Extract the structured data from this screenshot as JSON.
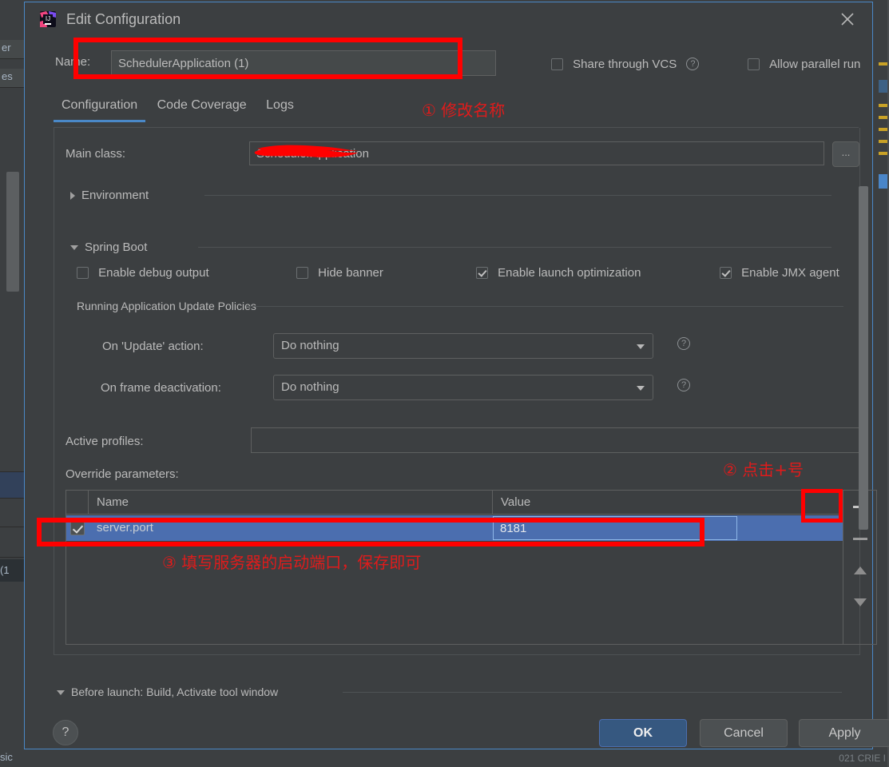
{
  "window": {
    "title": "Edit Configuration",
    "logo_icon": "intellij-idea-logo",
    "close_icon": "close-icon"
  },
  "name_row": {
    "label": "Name:",
    "value": "SchedulerApplication (1)",
    "share_vcs": {
      "label": "Share through VCS",
      "checked": false,
      "help_icon": "?"
    },
    "allow_parallel": {
      "label": "Allow parallel run",
      "checked": false
    }
  },
  "tabs": [
    {
      "label": "Configuration",
      "active": true
    },
    {
      "label": "Code Coverage",
      "active": false
    },
    {
      "label": "Logs",
      "active": false
    }
  ],
  "configuration": {
    "main_class": {
      "label": "Main class:",
      "value": "SchedulerApplication",
      "browse_label": "..."
    },
    "environment": {
      "label": "Environment",
      "expanded": false,
      "triangle_icon": "triangle-right-icon"
    },
    "spring_boot": {
      "label": "Spring Boot",
      "expanded": true,
      "triangle_icon": "triangle-down-icon"
    },
    "boot_checkboxes": [
      {
        "label": "Enable debug output",
        "checked": false
      },
      {
        "label": "Hide banner",
        "checked": false
      },
      {
        "label": "Enable launch optimization",
        "checked": true
      },
      {
        "label": "Enable JMX agent",
        "checked": true
      }
    ],
    "policies": {
      "title": "Running Application Update Policies",
      "update_action": {
        "label": "On 'Update' action:",
        "value": "Do nothing",
        "help_icon": "?"
      },
      "frame_deactivation": {
        "label": "On frame deactivation:",
        "value": "Do nothing",
        "help_icon": "?"
      }
    },
    "active_profiles": {
      "label": "Active profiles:",
      "value": "",
      "placeholder": ""
    },
    "override_parameters": {
      "label": "Override parameters:",
      "columns": [
        "Name",
        "Value"
      ],
      "rows": [
        {
          "checked": true,
          "name": "server.port",
          "value": "8181",
          "selected": true
        }
      ],
      "tools": {
        "add": "+",
        "remove": "−",
        "move_up": "move-up-icon",
        "move_down": "move-down-icon"
      }
    }
  },
  "before_launch": {
    "label": "Before launch: Build, Activate tool window",
    "triangle_icon": "triangle-down-icon"
  },
  "footer": {
    "help_label": "?",
    "ok_label": "OK",
    "cancel_label": "Cancel",
    "apply_label": "Apply"
  },
  "annotations": [
    {
      "id": "a1",
      "text": "①  修改名称"
    },
    {
      "id": "a2",
      "text": "②  点击+号"
    },
    {
      "id": "a3",
      "text": "③  填写服务器的启动端口，保存即可"
    }
  ],
  "background": {
    "left_fragments": [
      "er",
      "es"
    ],
    "left_tab": "(1",
    "left_bottom": "sic",
    "bottom_right": "021  CRIE  I"
  },
  "colors": {
    "dialog_bg": "#3c3f41",
    "accent_blue": "#4a88c7",
    "selection_blue": "#4b6eaf",
    "annotation_red": "#ff0000",
    "text": "#bbbbbb"
  }
}
